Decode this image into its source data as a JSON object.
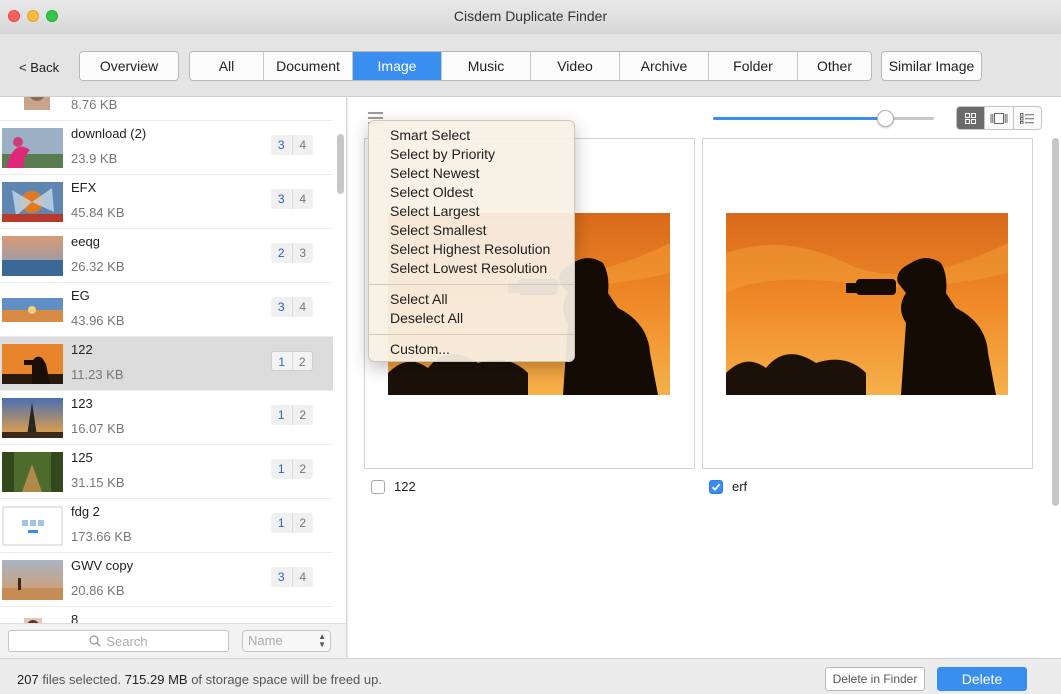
{
  "window": {
    "title": "Cisdem Duplicate Finder"
  },
  "toolbar": {
    "back_label": "< Back",
    "overview_label": "Overview",
    "tabs": [
      {
        "label": "All",
        "active": false
      },
      {
        "label": "Document",
        "active": false
      },
      {
        "label": "Image",
        "active": true
      },
      {
        "label": "Music",
        "active": false
      },
      {
        "label": "Video",
        "active": false
      },
      {
        "label": "Archive",
        "active": false
      },
      {
        "label": "Folder",
        "active": false
      },
      {
        "label": "Other",
        "active": false
      }
    ],
    "similar_label": "Similar Image"
  },
  "sidebar": {
    "items": [
      {
        "name": "",
        "size": "8.76 KB",
        "count_selected": "",
        "count_total": ""
      },
      {
        "name": "download (2)",
        "size": "23.9 KB",
        "count_selected": "3",
        "count_total": "4"
      },
      {
        "name": "EFX",
        "size": "45.84 KB",
        "count_selected": "3",
        "count_total": "4"
      },
      {
        "name": "eeqg",
        "size": "26.32 KB",
        "count_selected": "2",
        "count_total": "3"
      },
      {
        "name": "EG",
        "size": "43.96 KB",
        "count_selected": "3",
        "count_total": "4"
      },
      {
        "name": "122",
        "size": "11.23 KB",
        "count_selected": "1",
        "count_total": "2",
        "selected": true
      },
      {
        "name": "123",
        "size": "16.07 KB",
        "count_selected": "1",
        "count_total": "2"
      },
      {
        "name": "125",
        "size": "31.15 KB",
        "count_selected": "1",
        "count_total": "2"
      },
      {
        "name": "fdg 2",
        "size": "173.66 KB",
        "count_selected": "1",
        "count_total": "2"
      },
      {
        "name": "GWV copy",
        "size": "20.86 KB",
        "count_selected": "3",
        "count_total": "4"
      },
      {
        "name": "8",
        "size": "",
        "count_selected": "",
        "count_total": ""
      }
    ],
    "search_placeholder": "Search",
    "sort_value": "Name"
  },
  "main": {
    "slider_value_percent": 78,
    "view_mode": "grid",
    "cards": [
      {
        "name": "122",
        "checked": false
      },
      {
        "name": "erf",
        "checked": true
      }
    ]
  },
  "dropdown": {
    "group1": [
      "Smart Select",
      "Select by Priority",
      "Select Newest",
      "Select Oldest",
      "Select Largest",
      "Select Smallest",
      "Select Highest Resolution",
      "Select Lowest Resolution"
    ],
    "group2": [
      "Select All",
      "Deselect All"
    ],
    "group3": [
      "Custom..."
    ]
  },
  "footer": {
    "files_selected": "207",
    "files_text": " files selected. ",
    "storage": "715.29 MB",
    "storage_text": " of storage space will be freed up.",
    "delete_in_finder_label": "Delete in Finder",
    "delete_label": "Delete"
  },
  "colors": {
    "accent": "#3a8ef0",
    "count_blue": "#2b62c8"
  }
}
